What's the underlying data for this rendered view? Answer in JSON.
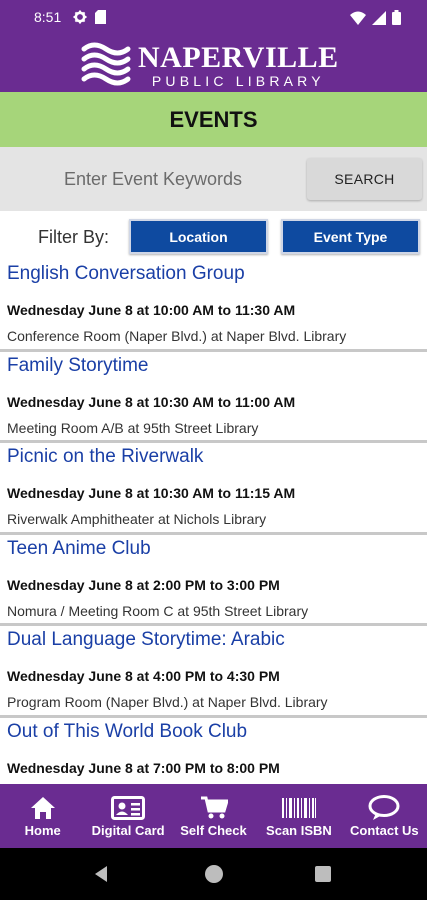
{
  "status_bar": {
    "time": "8:51",
    "icons_left": [
      "settings-icon",
      "sd-card-icon"
    ],
    "icons_right": [
      "wifi-icon",
      "signal-icon",
      "battery-icon"
    ]
  },
  "header": {
    "logo_title": "NAPERVILLE",
    "logo_subtitle": "PUBLIC LIBRARY",
    "logo_icon": "book-waves-icon"
  },
  "page": {
    "title": "EVENTS"
  },
  "search": {
    "placeholder": "Enter Event Keywords",
    "value": "",
    "button_label": "SEARCH"
  },
  "filter": {
    "label": "Filter By:",
    "location_label": "Location",
    "type_label": "Event Type"
  },
  "events": [
    {
      "title": "English Conversation Group",
      "time": "Wednesday June 8 at 10:00 AM to 11:30 AM",
      "place": "Conference Room (Naper Blvd.) at Naper Blvd. Library"
    },
    {
      "title": "Family Storytime",
      "time": "Wednesday June 8 at 10:30 AM to 11:00 AM",
      "place": "Meeting Room A/B at 95th Street Library"
    },
    {
      "title": "Picnic on the Riverwalk",
      "time": "Wednesday June 8 at 10:30 AM to 11:15 AM",
      "place": "Riverwalk Amphitheater at Nichols Library"
    },
    {
      "title": "Teen Anime Club",
      "time": "Wednesday June 8 at 2:00 PM to 3:00 PM",
      "place": "Nomura / Meeting Room C at 95th Street Library"
    },
    {
      "title": "Dual Language Storytime: Arabic",
      "time": "Wednesday June 8 at 4:00 PM to 4:30 PM",
      "place": "Program Room (Naper Blvd.) at Naper Blvd. Library"
    },
    {
      "title": "Out of This World Book Club",
      "time": "Wednesday June 8 at 7:00 PM to 8:00 PM",
      "place": ""
    }
  ],
  "bottom_nav": [
    {
      "label": "Home",
      "icon": "home-icon"
    },
    {
      "label": "Digital Card",
      "icon": "id-card-icon"
    },
    {
      "label": "Self Check",
      "icon": "cart-icon"
    },
    {
      "label": "Scan ISBN",
      "icon": "barcode-icon"
    },
    {
      "label": "Contact Us",
      "icon": "chat-bubble-icon"
    }
  ],
  "colors": {
    "brand_purple": "#6a2c91",
    "events_green": "#a6d57a",
    "filter_blue": "#0e4aa0",
    "title_blue": "#1a3fa6"
  }
}
